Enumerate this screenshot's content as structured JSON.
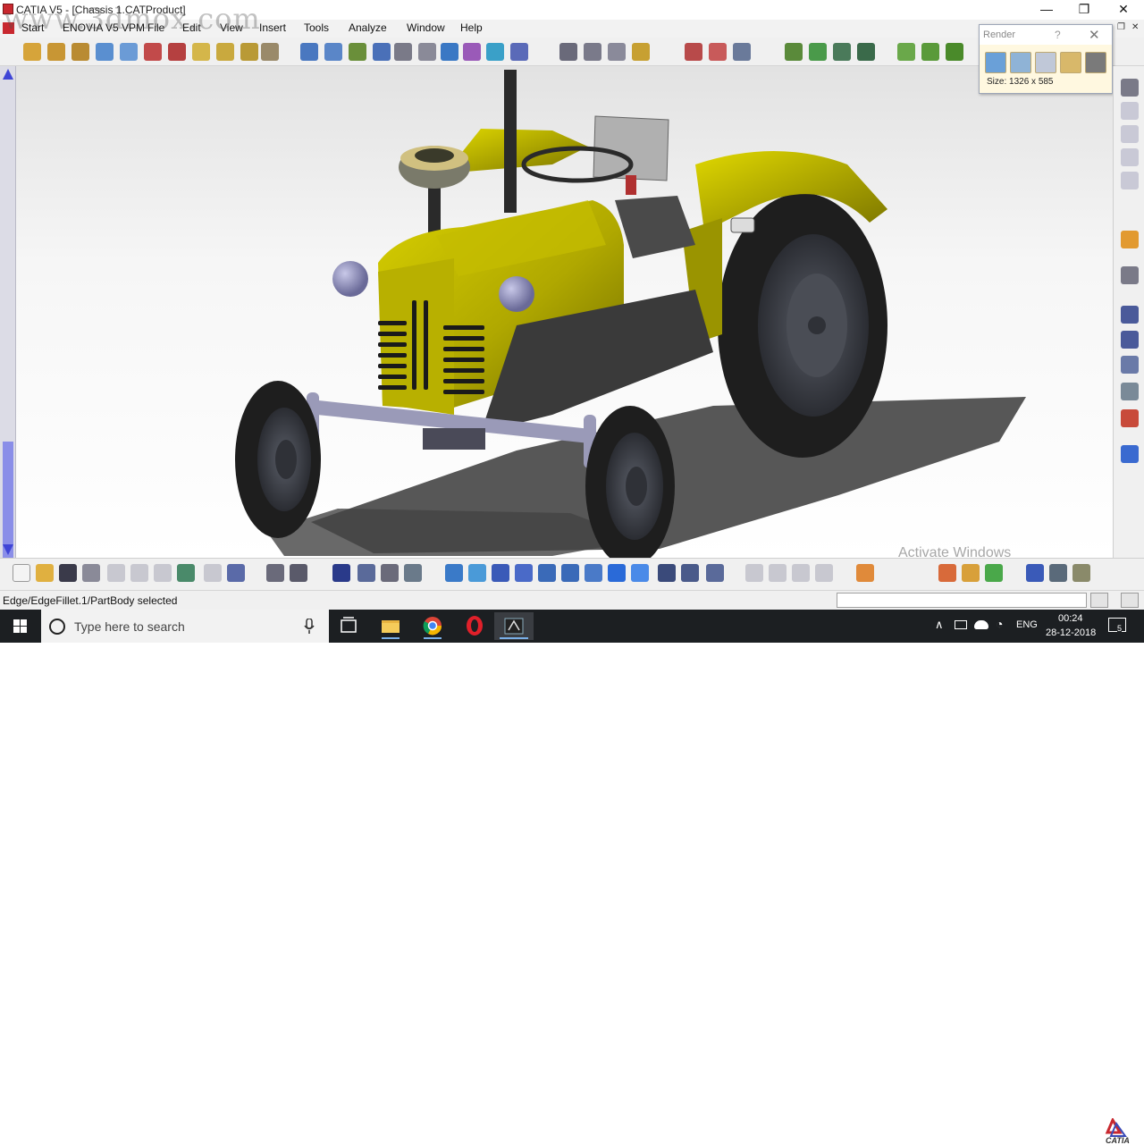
{
  "window": {
    "title": "CATIA V5 - [Chassis 1.CATProduct]",
    "min_glyph": "—",
    "max_glyph": "❐",
    "close_glyph": "✕"
  },
  "menubar": {
    "items": [
      "Start",
      "ENOVIA V5 VPM",
      "File",
      "Edit",
      "View",
      "Insert",
      "Tools",
      "Analyze",
      "Window",
      "Help"
    ]
  },
  "watermark": "www.3dmox.com",
  "render_panel": {
    "title": "Render",
    "help": "?",
    "close": "✕",
    "size_label": "Size: 1326 x 585",
    "icons": [
      "render-image-icon",
      "render-settings-icon",
      "render-snapshot-icon",
      "render-camera-icon",
      "render-save-icon"
    ]
  },
  "status": {
    "text": "Edge/EdgeFillet.1/PartBody selected"
  },
  "activate_windows": "Activate Windows",
  "brand_logo": "CATIA",
  "taskbar": {
    "search_placeholder": "Type here to search",
    "language": "ENG",
    "time": "00:24",
    "date": "28-12-2018",
    "notification_count": "5",
    "apps": [
      "task-view-icon",
      "file-explorer-icon",
      "chrome-icon",
      "opera-icon",
      "catia-task-icon"
    ]
  },
  "colors": {
    "tractor_body": "#b8b000",
    "tractor_shadow": "#6e6a00",
    "tire": "#1e1e1e",
    "rim": "#3c3f47",
    "axle": "#9a9ab8",
    "accent_blue": "#3f45d6"
  }
}
